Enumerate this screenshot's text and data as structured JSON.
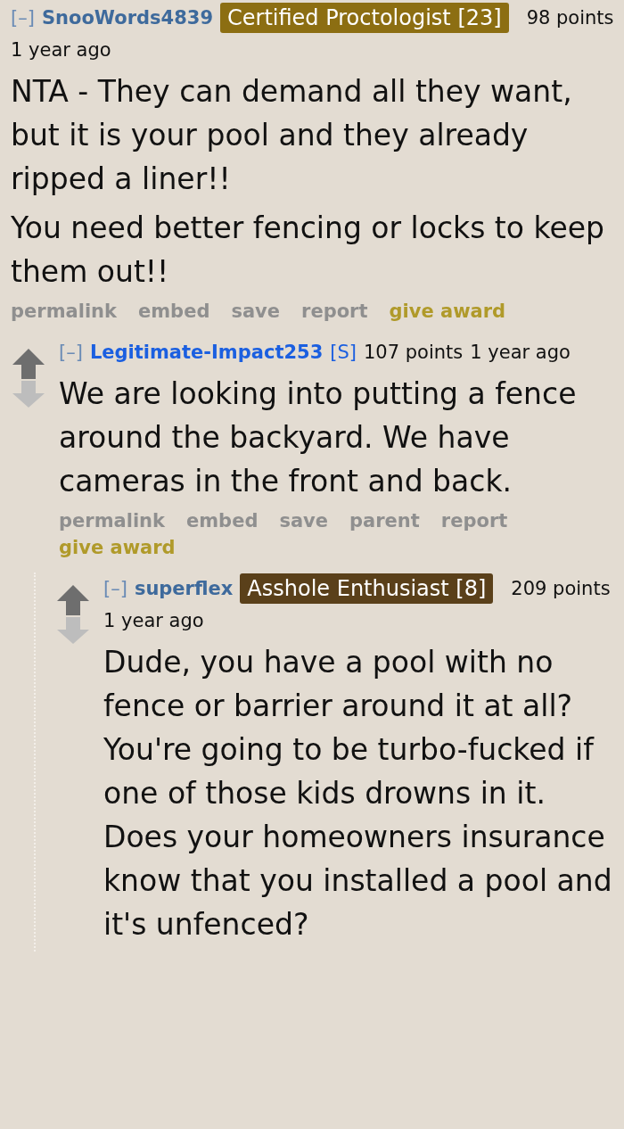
{
  "comments": [
    {
      "toggle": "[–]",
      "author": "SnooWords4839",
      "submitter": false,
      "flair": {
        "text": "Certified Proctologist [23]",
        "color": "#8c6e12"
      },
      "score": "98 points",
      "time": "1 year ago",
      "vote_arrows": false,
      "paragraphs": [
        "NTA - They can demand all they want, but it is your pool and they already ripped a liner!!",
        "You need better fencing or locks to keep them out!!"
      ],
      "buttons": [
        {
          "label": "permalink",
          "kind": "link"
        },
        {
          "label": "embed",
          "kind": "link"
        },
        {
          "label": "save",
          "kind": "link"
        },
        {
          "label": "report",
          "kind": "link"
        },
        {
          "label": "give award",
          "kind": "award"
        }
      ],
      "children": [
        {
          "toggle": "[–]",
          "author": "Legitimate-Impact253",
          "submitter": true,
          "submitter_mark": "[S]",
          "score": "107 points",
          "time": "1 year ago",
          "vote_arrows": true,
          "paragraphs": [
            "We are looking into putting a fence around the backyard. We have cameras in the front and back."
          ],
          "buttons": [
            {
              "label": "permalink",
              "kind": "link"
            },
            {
              "label": "embed",
              "kind": "link"
            },
            {
              "label": "save",
              "kind": "link"
            },
            {
              "label": "parent",
              "kind": "link"
            },
            {
              "label": "report",
              "kind": "link"
            },
            {
              "label": "give award",
              "kind": "award"
            }
          ],
          "children": [
            {
              "toggle": "[–]",
              "author": "superflex",
              "submitter": false,
              "flair": {
                "text": "Asshole Enthusiast [8]",
                "color": "#5a401a"
              },
              "score": "209 points",
              "time": "1 year ago",
              "vote_arrows": true,
              "paragraphs": [
                "Dude, you have a pool with no fence or barrier around it at all? You're going to be turbo-fucked if one of those kids drowns in it. Does your homeowners insurance know that you installed a pool and it's unfenced?"
              ]
            }
          ]
        }
      ]
    }
  ]
}
